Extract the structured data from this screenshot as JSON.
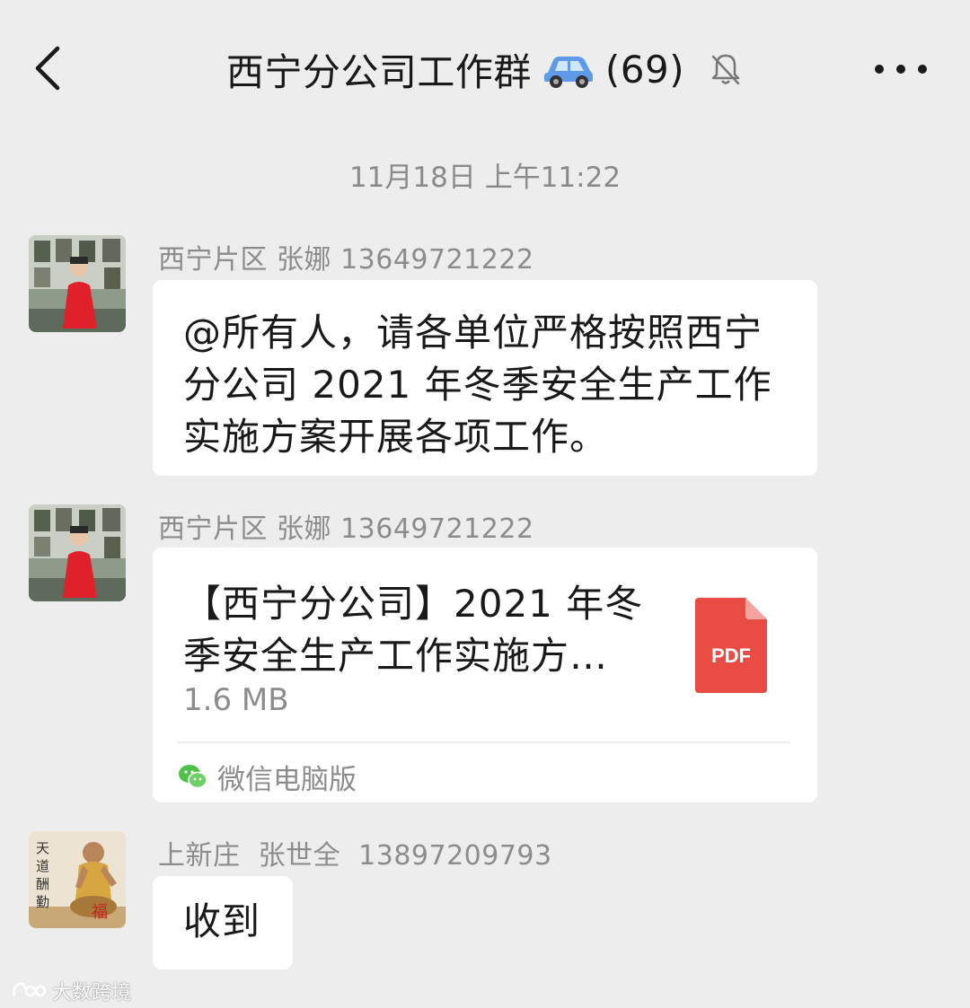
{
  "header": {
    "title": "西宁分公司工作群",
    "member_count": "(69)"
  },
  "timestamp": "11月18日 上午11:22",
  "messages": [
    {
      "sender": "西宁片区 张娜 13649721222",
      "text": "@所有人，请各单位严格按照西宁\n分公司 2021 年冬季安全生产工作\n实施方案开展各项工作。"
    },
    {
      "sender": "西宁片区 张娜 13649721222",
      "file": {
        "title": "【西宁分公司】2021 年冬季安全生产工作实施方…",
        "size": "1.6 MB",
        "type_label": "PDF",
        "source": "微信电脑版"
      }
    },
    {
      "sender": "上新庄  张世全  13897209793",
      "text": "收到",
      "avatar_text": [
        "天",
        "道",
        "酬",
        "勤"
      ]
    }
  ],
  "watermark": "大数跨境",
  "colors": {
    "background": "#ededed",
    "bubble": "#ffffff",
    "pdf_red": "#e94c45",
    "wechat_green": "#4fc14a"
  }
}
